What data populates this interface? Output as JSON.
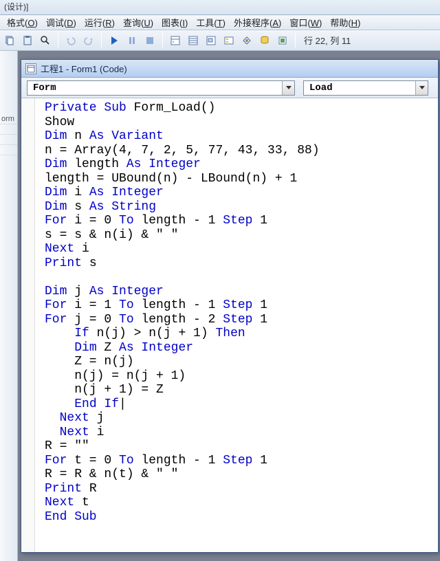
{
  "titleFragment": "(设计)]",
  "menus": [
    {
      "label": "格式",
      "u": "O"
    },
    {
      "label": "调试",
      "u": "D"
    },
    {
      "label": "运行",
      "u": "R"
    },
    {
      "label": "查询",
      "u": "U"
    },
    {
      "label": "图表",
      "u": "I"
    },
    {
      "label": "工具",
      "u": "T"
    },
    {
      "label": "外接程序",
      "u": "A"
    },
    {
      "label": "窗口",
      "u": "W"
    },
    {
      "label": "帮助",
      "u": "H"
    }
  ],
  "cursorStatus": "行 22, 列 11",
  "leftPanelItem": "orm",
  "codeWindow": {
    "title": "工程1 - Form1 (Code)",
    "objectDropdown": "Form",
    "procDropdown": "Load"
  },
  "code": [
    {
      "t": "plain",
      "segs": [
        {
          "c": "kw",
          "t": "Private Sub"
        },
        {
          "t": " Form_Load()"
        }
      ]
    },
    {
      "t": "plain",
      "segs": [
        {
          "t": "Show"
        }
      ]
    },
    {
      "t": "plain",
      "segs": [
        {
          "c": "kw",
          "t": "Dim"
        },
        {
          "t": " n "
        },
        {
          "c": "kw",
          "t": "As Variant"
        }
      ]
    },
    {
      "t": "plain",
      "segs": [
        {
          "t": "n = Array(4, 7, 2, 5, 77, 43, 33, 88)"
        }
      ]
    },
    {
      "t": "plain",
      "segs": [
        {
          "c": "kw",
          "t": "Dim"
        },
        {
          "t": " length "
        },
        {
          "c": "kw",
          "t": "As Integer"
        }
      ]
    },
    {
      "t": "plain",
      "segs": [
        {
          "t": "length = UBound(n) - LBound(n) + 1"
        }
      ]
    },
    {
      "t": "plain",
      "segs": [
        {
          "c": "kw",
          "t": "Dim"
        },
        {
          "t": " i "
        },
        {
          "c": "kw",
          "t": "As Integer"
        }
      ]
    },
    {
      "t": "plain",
      "segs": [
        {
          "c": "kw",
          "t": "Dim"
        },
        {
          "t": " s "
        },
        {
          "c": "kw",
          "t": "As String"
        }
      ]
    },
    {
      "t": "plain",
      "segs": [
        {
          "c": "kw",
          "t": "For"
        },
        {
          "t": " i = 0 "
        },
        {
          "c": "kw",
          "t": "To"
        },
        {
          "t": " length - 1 "
        },
        {
          "c": "kw",
          "t": "Step"
        },
        {
          "t": " 1"
        }
      ]
    },
    {
      "t": "plain",
      "segs": [
        {
          "t": "s = s & n(i) & \" \""
        }
      ]
    },
    {
      "t": "plain",
      "segs": [
        {
          "c": "kw",
          "t": "Next"
        },
        {
          "t": " i"
        }
      ]
    },
    {
      "t": "plain",
      "segs": [
        {
          "c": "kw",
          "t": "Print"
        },
        {
          "t": " s"
        }
      ]
    },
    {
      "t": "plain",
      "segs": [
        {
          "t": ""
        }
      ]
    },
    {
      "t": "plain",
      "segs": [
        {
          "c": "kw",
          "t": "Dim"
        },
        {
          "t": " j "
        },
        {
          "c": "kw",
          "t": "As Integer"
        }
      ]
    },
    {
      "t": "plain",
      "segs": [
        {
          "c": "kw",
          "t": "For"
        },
        {
          "t": " i = 1 "
        },
        {
          "c": "kw",
          "t": "To"
        },
        {
          "t": " length - 1 "
        },
        {
          "c": "kw",
          "t": "Step"
        },
        {
          "t": " 1"
        }
      ]
    },
    {
      "t": "plain",
      "segs": [
        {
          "c": "kw",
          "t": "For"
        },
        {
          "t": " j = 0 "
        },
        {
          "c": "kw",
          "t": "To"
        },
        {
          "t": " length - 2 "
        },
        {
          "c": "kw",
          "t": "Step"
        },
        {
          "t": " 1"
        }
      ]
    },
    {
      "t": "plain",
      "segs": [
        {
          "t": "    "
        },
        {
          "c": "kw",
          "t": "If"
        },
        {
          "t": " n(j) > n(j + 1) "
        },
        {
          "c": "kw",
          "t": "Then"
        }
      ]
    },
    {
      "t": "plain",
      "segs": [
        {
          "t": "    "
        },
        {
          "c": "kw",
          "t": "Dim"
        },
        {
          "t": " Z "
        },
        {
          "c": "kw",
          "t": "As Integer"
        }
      ]
    },
    {
      "t": "plain",
      "segs": [
        {
          "t": "    Z = n(j)"
        }
      ]
    },
    {
      "t": "plain",
      "segs": [
        {
          "t": "    n(j) = n(j + 1)"
        }
      ]
    },
    {
      "t": "plain",
      "segs": [
        {
          "t": "    n(j + 1) = Z"
        }
      ]
    },
    {
      "t": "plain",
      "segs": [
        {
          "t": "    "
        },
        {
          "c": "kw",
          "t": "End If"
        },
        {
          "t": "|"
        }
      ]
    },
    {
      "t": "plain",
      "segs": [
        {
          "t": "  "
        },
        {
          "c": "kw",
          "t": "Next"
        },
        {
          "t": " j"
        }
      ]
    },
    {
      "t": "plain",
      "segs": [
        {
          "t": "  "
        },
        {
          "c": "kw",
          "t": "Next"
        },
        {
          "t": " i"
        }
      ]
    },
    {
      "t": "plain",
      "segs": [
        {
          "t": "R = \"\""
        }
      ]
    },
    {
      "t": "plain",
      "segs": [
        {
          "c": "kw",
          "t": "For"
        },
        {
          "t": " t = 0 "
        },
        {
          "c": "kw",
          "t": "To"
        },
        {
          "t": " length - 1 "
        },
        {
          "c": "kw",
          "t": "Step"
        },
        {
          "t": " 1"
        }
      ]
    },
    {
      "t": "plain",
      "segs": [
        {
          "t": "R = R & n(t) & \" \""
        }
      ]
    },
    {
      "t": "plain",
      "segs": [
        {
          "c": "kw",
          "t": "Print"
        },
        {
          "t": " R"
        }
      ]
    },
    {
      "t": "plain",
      "segs": [
        {
          "c": "kw",
          "t": "Next"
        },
        {
          "t": " t"
        }
      ]
    },
    {
      "t": "plain",
      "segs": [
        {
          "c": "kw",
          "t": "End Sub"
        }
      ]
    }
  ]
}
